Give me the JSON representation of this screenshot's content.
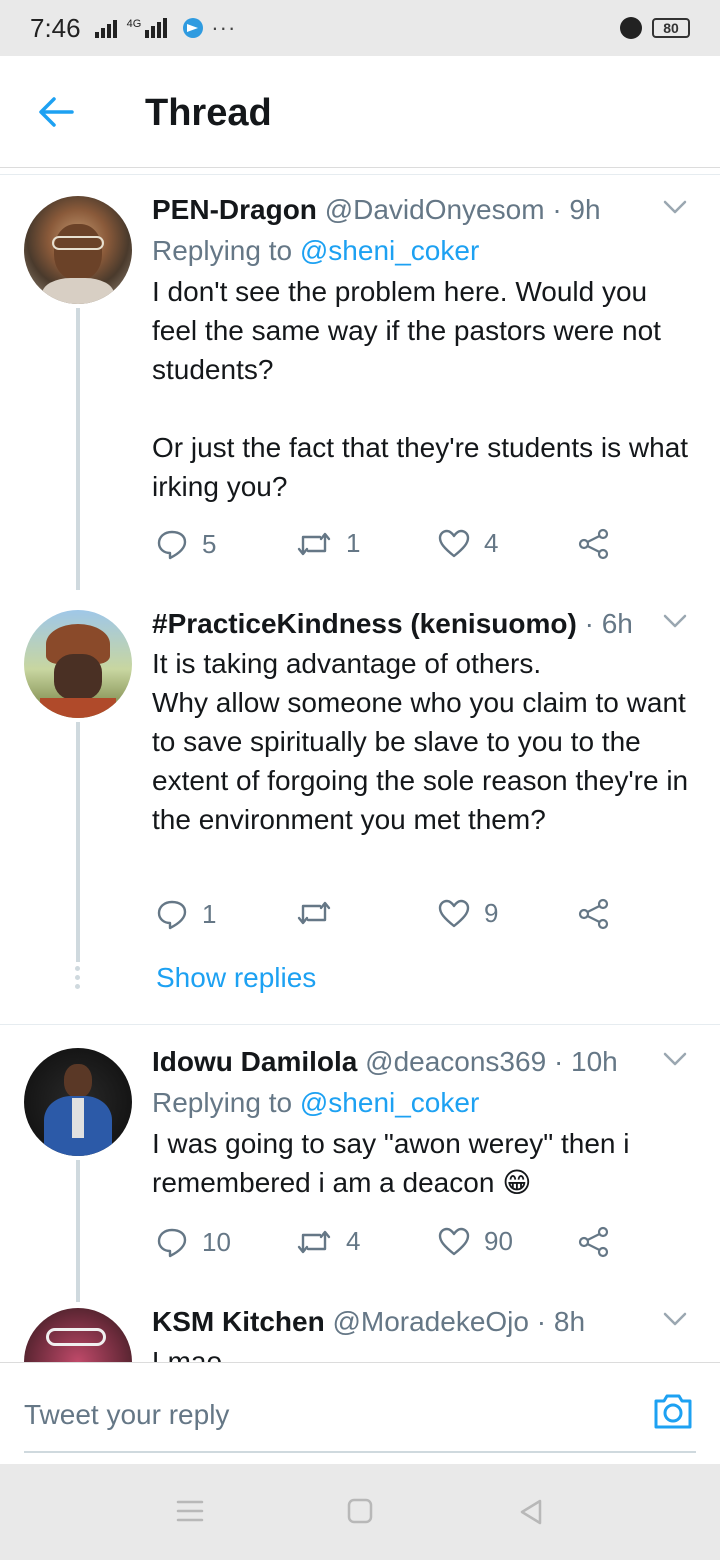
{
  "status_bar": {
    "time": "7:46",
    "network": "4G",
    "more": "···",
    "battery": "80"
  },
  "header": {
    "title": "Thread",
    "back_icon": "arrow-left-icon",
    "accent_color": "#1da1f2"
  },
  "tweets": [
    {
      "name": "PEN-Dragon",
      "handle": "@DavidOnyesom",
      "time": "· 9h",
      "replying_prefix": "Replying to ",
      "replying_to": "@sheni_coker",
      "text": "I don't see the problem here. Would you feel the same way if the pastors were not students?\n\nOr just the fact that they're students is what irking you?",
      "replies": "5",
      "retweets": "1",
      "likes": "4"
    },
    {
      "name": "#PracticeKindness (kenisuomo)",
      "handle": "",
      "time": "· 6h",
      "text": "It is taking advantage of others.\nWhy allow someone who you claim to want to save spiritually be slave to you to the extent of forgoing the sole reason they're in the environment you met them?",
      "replies": "1",
      "retweets": "",
      "likes": "9",
      "show_replies": "Show replies"
    },
    {
      "name": "Idowu Damilola",
      "handle": "@deacons369",
      "time": "· 10h",
      "replying_prefix": "Replying to ",
      "replying_to": "@sheni_coker",
      "text": "I was going to say \"awon werey\" then i remembered i am a deacon",
      "emoji": "😁",
      "replies": "10",
      "retweets": "4",
      "likes": "90"
    },
    {
      "name": "KSM Kitchen",
      "handle": "@MoradekeOjo",
      "time": "· 8h",
      "text": "Lmao"
    }
  ],
  "reply_box": {
    "placeholder": "Tweet your reply",
    "camera_icon": "camera-icon"
  },
  "nav_bar": {
    "menu_icon": "menu-icon",
    "home_icon": "square-home-icon",
    "back_icon": "triangle-back-icon"
  }
}
